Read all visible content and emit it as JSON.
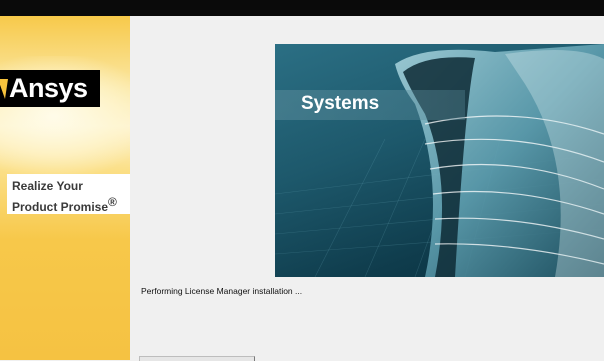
{
  "window": {
    "background": "#f0f0f0"
  },
  "sidebar": {
    "logo_text": "Ansys",
    "logo_icon": "ansys-logo-mark-icon",
    "tagline_line1": "Realize Your",
    "tagline_line2": "Product Promise",
    "tagline_mark": "®",
    "accent": "#f6c33d"
  },
  "banner": {
    "label": "Systems"
  },
  "status": {
    "message": "Performing License Manager installation ..."
  },
  "progress": {
    "percent": 0
  }
}
